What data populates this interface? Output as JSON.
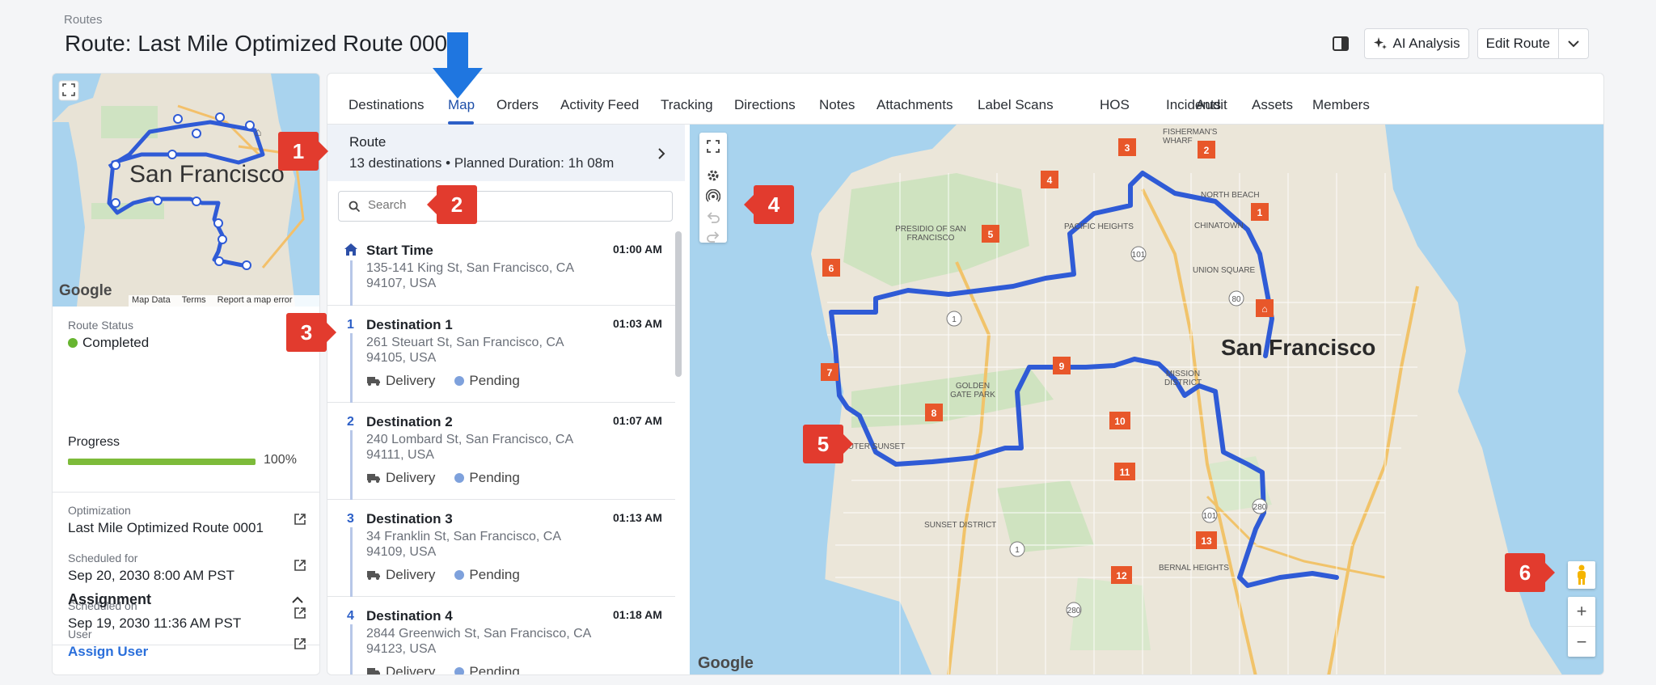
{
  "breadcrumb": "Routes",
  "title": "Route: Last Mile Optimized Route 0001",
  "header": {
    "ai_label": "AI Analysis",
    "edit_label": "Edit Route"
  },
  "left": {
    "map_footer": {
      "map_data": "Map Data",
      "terms": "Terms",
      "report": "Report a map error",
      "brand": "Google",
      "city": "San Francisco"
    },
    "status_label": "Route Status",
    "status_value": "Completed",
    "progress_label": "Progress",
    "progress_value": "100%",
    "progress_fraction": 1.0,
    "optimization_label": "Optimization",
    "optimization_value": "Last Mile Optimized Route 0001",
    "scheduled_for_label": "Scheduled for",
    "scheduled_for_value": "Sep 20, 2030 8:00 AM PST",
    "scheduled_on_label": "Scheduled on",
    "scheduled_on_value": "Sep 19, 2030 11:36 AM PST",
    "assignment_label": "Assignment",
    "user_label": "User",
    "user_value": "Assign User"
  },
  "tabs": [
    "Destinations",
    "Map",
    "Orders",
    "Activity Feed",
    "Tracking",
    "Directions",
    "Notes",
    "Attachments",
    "Label Scans",
    "HOS",
    "Incidents",
    "Audit",
    "Assets",
    "Members"
  ],
  "active_tab": "Map",
  "route_summary": {
    "title": "Route",
    "details": "13 destinations • Planned Duration: 1h 08m"
  },
  "search": {
    "placeholder": "Search"
  },
  "stops": [
    {
      "num": "",
      "name": "Start Time",
      "address": "135-141 King St, San Francisco, CA 94107, USA",
      "time": "01:00 AM",
      "type": "",
      "status": ""
    },
    {
      "num": "1",
      "name": "Destination 1",
      "address": "261 Steuart St, San Francisco, CA 94105, USA",
      "time": "01:03 AM",
      "type": "Delivery",
      "status": "Pending"
    },
    {
      "num": "2",
      "name": "Destination 2",
      "address": "240 Lombard St, San Francisco, CA 94111, USA",
      "time": "01:07 AM",
      "type": "Delivery",
      "status": "Pending"
    },
    {
      "num": "3",
      "name": "Destination 3",
      "address": "34 Franklin St, San Francisco, CA 94109, USA",
      "time": "01:13 AM",
      "type": "Delivery",
      "status": "Pending"
    },
    {
      "num": "4",
      "name": "Destination 4",
      "address": "2844 Greenwich St, San Francisco, CA 94123, USA",
      "time": "01:18 AM",
      "type": "Delivery",
      "status": "Pending"
    }
  ],
  "map": {
    "city": "San Francisco",
    "brand": "Google",
    "labels": [
      "FISHERMAN'S WHARF",
      "NORTH BEACH",
      "CHINATOWN",
      "UNION SQUARE",
      "PRESIDIO OF SAN FRANCISCO",
      "PACIFIC HEIGHTS",
      "GOLDEN GATE PARK",
      "OUTER SUNSET",
      "SUNSET DISTRICT",
      "MISSION DISTRICT",
      "BERNAL HEIGHTS"
    ],
    "markers": [
      "1",
      "2",
      "3",
      "4",
      "5",
      "6",
      "7",
      "8",
      "9",
      "10",
      "11",
      "12",
      "13"
    ],
    "highways": [
      "101",
      "80",
      "1",
      "280"
    ],
    "route_color": "#2f5bd6",
    "marker_color": "#e8572a"
  },
  "callouts": [
    "1",
    "2",
    "3",
    "4",
    "5",
    "6"
  ],
  "colors": {
    "accent": "#2c5fc7",
    "status_completed": "#67b530",
    "pending": "#7ea1dc",
    "callout": "#e23b2e",
    "pointer_arrow": "#1f76e0"
  }
}
